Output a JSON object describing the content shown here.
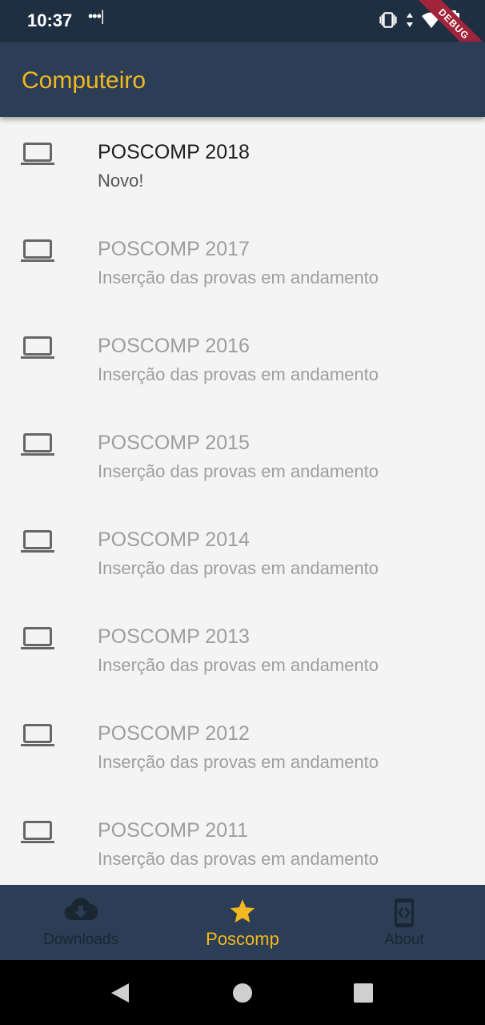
{
  "status_bar": {
    "time": "10:37",
    "dots": "•••|"
  },
  "debug_banner": "DEBUG",
  "app_bar": {
    "title": "Computeiro"
  },
  "list": [
    {
      "title": "POSCOMP 2018",
      "subtitle": "Novo!",
      "icon": "laptop-icon",
      "active": true
    },
    {
      "title": "POSCOMP 2017",
      "subtitle": "Inserção das provas em andamento",
      "icon": "laptop-icon",
      "active": false
    },
    {
      "title": "POSCOMP 2016",
      "subtitle": "Inserção das provas em andamento",
      "icon": "laptop-icon",
      "active": false
    },
    {
      "title": "POSCOMP 2015",
      "subtitle": "Inserção das provas em andamento",
      "icon": "laptop-icon",
      "active": false
    },
    {
      "title": "POSCOMP 2014",
      "subtitle": "Inserção das provas em andamento",
      "icon": "laptop-icon",
      "active": false
    },
    {
      "title": "POSCOMP 2013",
      "subtitle": "Inserção das provas em andamento",
      "icon": "laptop-icon",
      "active": false
    },
    {
      "title": "POSCOMP 2012",
      "subtitle": "Inserção das provas em andamento",
      "icon": "laptop-icon",
      "active": false
    },
    {
      "title": "POSCOMP 2011",
      "subtitle": "Inserção das provas em andamento",
      "icon": "laptop-icon",
      "active": false
    }
  ],
  "bottom_nav": {
    "items": [
      {
        "label": "Downloads",
        "icon": "cloud-download-icon",
        "active": false
      },
      {
        "label": "Poscomp",
        "icon": "star-icon",
        "active": true
      },
      {
        "label": "About",
        "icon": "developer-mode-icon",
        "active": false
      }
    ]
  },
  "colors": {
    "app_bar": "#2c3e55",
    "accent": "#f3b81f",
    "status_bar": "#1f2f42",
    "background": "#f4f4f4"
  }
}
